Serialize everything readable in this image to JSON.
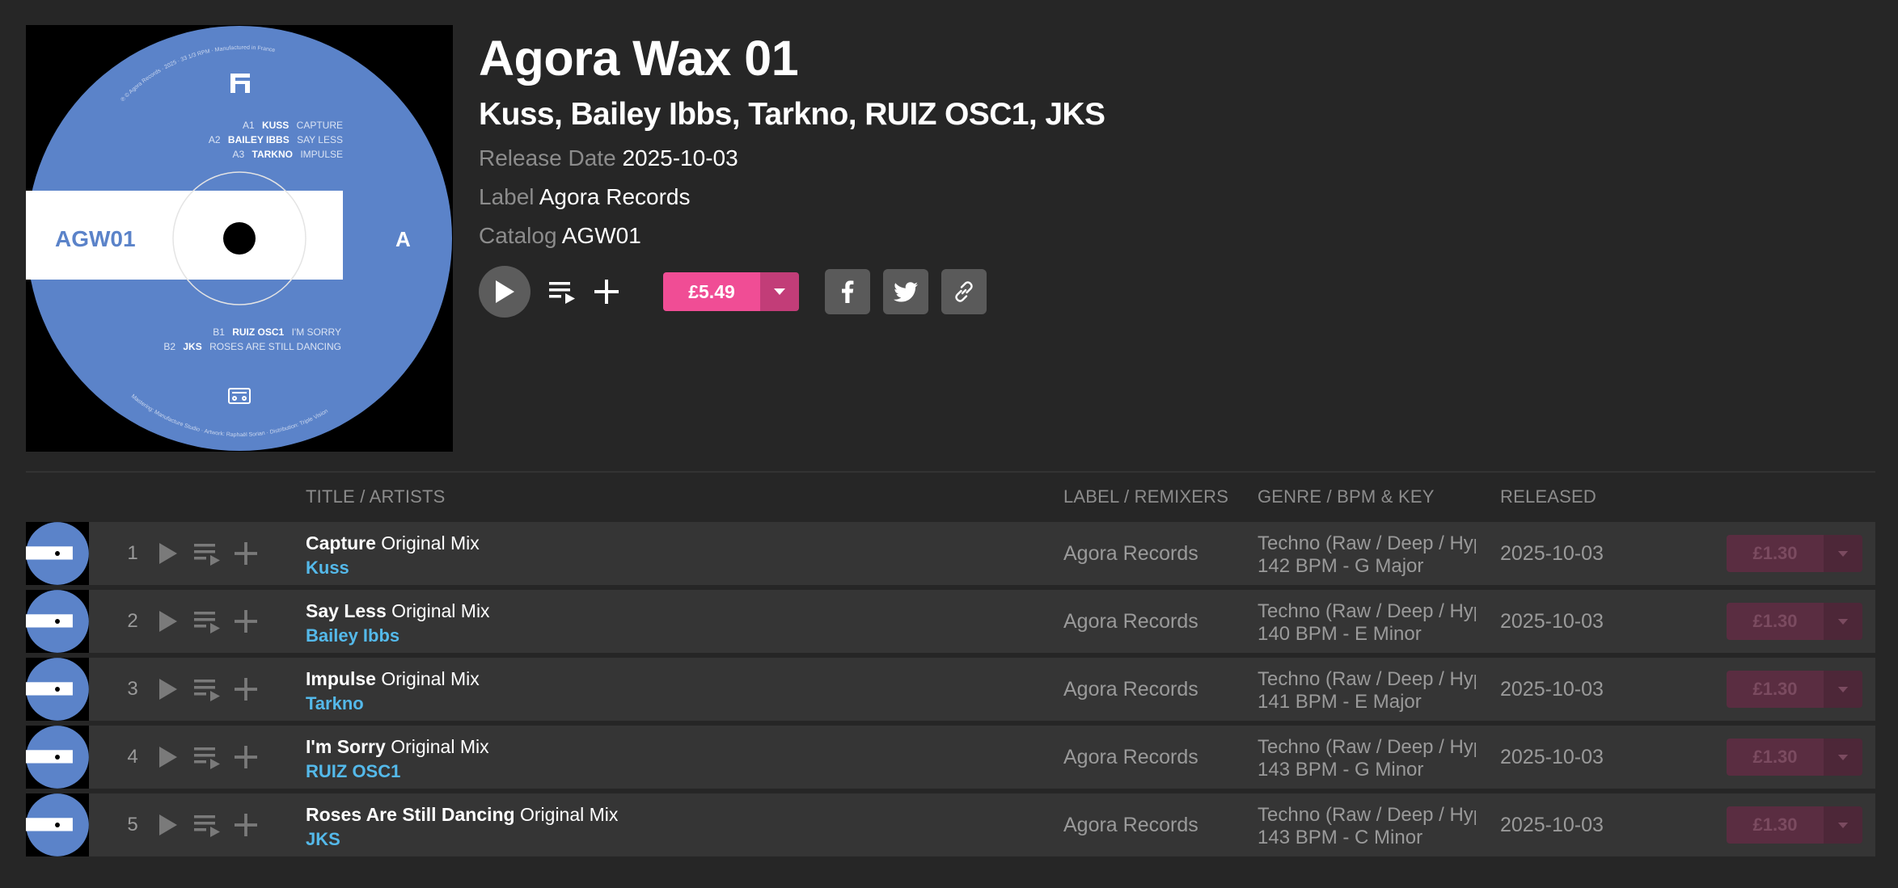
{
  "release": {
    "title": "Agora Wax 01",
    "artists": "Kuss, Bailey Ibbs, Tarkno, RUIZ OSC1, JKS",
    "release_date_label": "Release Date",
    "release_date": "2025-10-03",
    "label_label": "Label",
    "label": "Agora Records",
    "catalog_label": "Catalog",
    "catalog": "AGW01",
    "price": "£5.49"
  },
  "artwork": {
    "catalog": "AGW01",
    "side": "A",
    "top_text": "℗ © Agora Records · 2025 · 33 1/3 RPM · Manufactured in France",
    "bottom_text": "Mastering: Manufacture Studio · Artwork: Raphaël Sorian · Distribution: Triple Vision",
    "side_a": [
      {
        "pos": "A1",
        "artist": "KUSS",
        "title": "CAPTURE"
      },
      {
        "pos": "A2",
        "artist": "BAILEY IBBS",
        "title": "SAY LESS"
      },
      {
        "pos": "A3",
        "artist": "TARKNO",
        "title": "IMPULSE"
      }
    ],
    "side_b": [
      {
        "pos": "B1",
        "artist": "RUIZ OSC1",
        "title": "I'M SORRY"
      },
      {
        "pos": "B2",
        "artist": "JKS",
        "title": "ROSES ARE STILL DANCING"
      }
    ],
    "disc_color": "#5b83c9"
  },
  "table": {
    "headers": {
      "title": "TITLE / ARTISTS",
      "label": "LABEL / REMIXERS",
      "genre": "GENRE / BPM & KEY",
      "released": "RELEASED"
    },
    "rows": [
      {
        "num": "1",
        "title": "Capture",
        "mix": "Original Mix",
        "artist": "Kuss",
        "label": "Agora Records",
        "genre": "Techno (Raw / Deep / Hypnotic)",
        "bpm_key": "142 BPM - G Major",
        "released": "2025-10-03",
        "price": "£1.30"
      },
      {
        "num": "2",
        "title": "Say Less",
        "mix": "Original Mix",
        "artist": "Bailey Ibbs",
        "label": "Agora Records",
        "genre": "Techno (Raw / Deep / Hypnotic)",
        "bpm_key": "140 BPM - E Minor",
        "released": "2025-10-03",
        "price": "£1.30"
      },
      {
        "num": "3",
        "title": "Impulse",
        "mix": "Original Mix",
        "artist": "Tarkno",
        "label": "Agora Records",
        "genre": "Techno (Raw / Deep / Hypnotic)",
        "bpm_key": "141 BPM - E Major",
        "released": "2025-10-03",
        "price": "£1.30"
      },
      {
        "num": "4",
        "title": "I'm Sorry",
        "mix": "Original Mix",
        "artist": "RUIZ OSC1",
        "label": "Agora Records",
        "genre": "Techno (Raw / Deep / Hypnotic)",
        "bpm_key": "143 BPM - G Minor",
        "released": "2025-10-03",
        "price": "£1.30"
      },
      {
        "num": "5",
        "title": "Roses Are Still Dancing",
        "mix": "Original Mix",
        "artist": "JKS",
        "label": "Agora Records",
        "genre": "Techno (Raw / Deep / Hypnotic)",
        "bpm_key": "143 BPM - C Minor",
        "released": "2025-10-03",
        "price": "£1.30"
      }
    ]
  },
  "colors": {
    "background": "#262626",
    "row_background": "#353535",
    "buy_accent": "#f04d95",
    "artist_link": "#54b9ea"
  },
  "icons": {
    "play": "play-icon",
    "queue": "add-to-queue-icon",
    "add": "plus-icon",
    "dropdown": "caret-down-icon",
    "facebook": "facebook-icon",
    "twitter": "twitter-icon",
    "link": "link-icon"
  }
}
